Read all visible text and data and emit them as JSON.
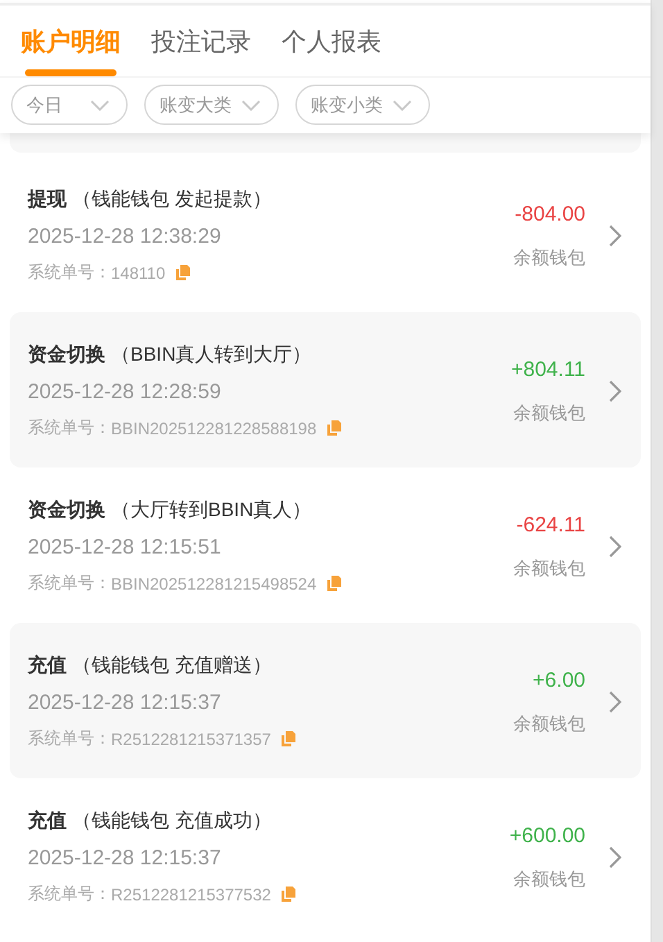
{
  "tabs": [
    {
      "label": "账户明细",
      "selected": true
    },
    {
      "label": "投注记录",
      "selected": false
    },
    {
      "label": "个人报表",
      "selected": false
    }
  ],
  "filters": [
    {
      "label": "今日"
    },
    {
      "label": "账变大类"
    },
    {
      "label": "账变小类"
    }
  ],
  "records": [
    {
      "type": "提现",
      "detail": "（钱能钱包 发起提款）",
      "time": "2025-12-28 12:38:29",
      "order_label": "系统单号：",
      "order_no": "148110",
      "amount": "-804.00",
      "kind": "out",
      "wallet": "余额钱包"
    },
    {
      "type": "资金切换",
      "detail": "（BBIN真人转到大厅）",
      "time": "2025-12-28 12:28:59",
      "order_label": "系统单号：",
      "order_no": "BBIN202512281228588198",
      "amount": "+804.11",
      "kind": "in",
      "wallet": "余额钱包"
    },
    {
      "type": "资金切换",
      "detail": "（大厅转到BBIN真人）",
      "time": "2025-12-28 12:15:51",
      "order_label": "系统单号：",
      "order_no": "BBIN202512281215498524",
      "amount": "-624.11",
      "kind": "out",
      "wallet": "余额钱包"
    },
    {
      "type": "充值",
      "detail": "（钱能钱包 充值赠送）",
      "time": "2025-12-28 12:15:37",
      "order_label": "系统单号：",
      "order_no": "R2512281215371357",
      "amount": "+6.00",
      "kind": "in",
      "wallet": "余额钱包"
    },
    {
      "type": "充值",
      "detail": "（钱能钱包 充值成功）",
      "time": "2025-12-28 12:15:37",
      "order_label": "系统单号：",
      "order_no": "R2512281215377532",
      "amount": "+600.00",
      "kind": "in",
      "wallet": "余额钱包"
    }
  ]
}
